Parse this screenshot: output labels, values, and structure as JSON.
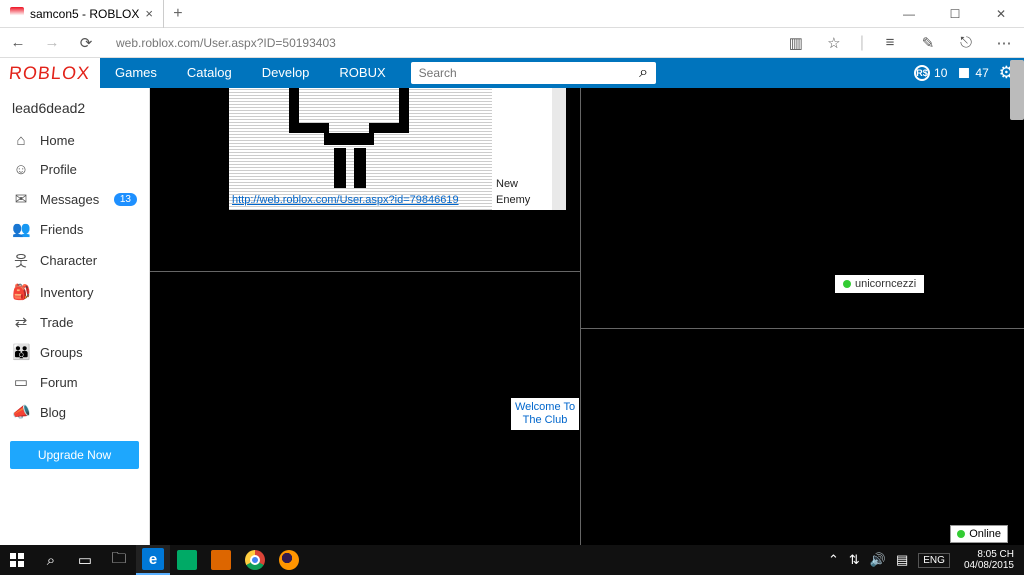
{
  "window": {
    "tab_title": "samcon5 - ROBLOX"
  },
  "addressbar": {
    "url": "web.roblox.com/User.aspx?ID=50193403"
  },
  "header": {
    "logo": "ROBLOX",
    "nav": [
      "Games",
      "Catalog",
      "Develop",
      "ROBUX"
    ],
    "search_placeholder": "Search",
    "robux": "10",
    "tix": "47"
  },
  "sidebar": {
    "username": "lead6dead2",
    "items": [
      {
        "label": "Home",
        "icon": "⌂"
      },
      {
        "label": "Profile",
        "icon": "☺"
      },
      {
        "label": "Messages",
        "icon": "✉",
        "badge": "13"
      },
      {
        "label": "Friends",
        "icon": "👥"
      },
      {
        "label": "Character",
        "icon": "웃"
      },
      {
        "label": "Inventory",
        "icon": "🎒"
      },
      {
        "label": "Trade",
        "icon": "⇄"
      },
      {
        "label": "Groups",
        "icon": "👪"
      },
      {
        "label": "Forum",
        "icon": "▭"
      },
      {
        "label": "Blog",
        "icon": "📣"
      }
    ],
    "upgrade": "Upgrade Now"
  },
  "content": {
    "ascii_side": [
      "New",
      "Enemy"
    ],
    "ascii_link": "http://web.roblox.com/User.aspx?id=79846619",
    "club_box": "Welcome To The Club",
    "friend_name": "unicorncezzi",
    "online_label": "Online"
  },
  "taskbar": {
    "lang": "ENG",
    "time": "8:05 CH",
    "date": "04/08/2015"
  }
}
